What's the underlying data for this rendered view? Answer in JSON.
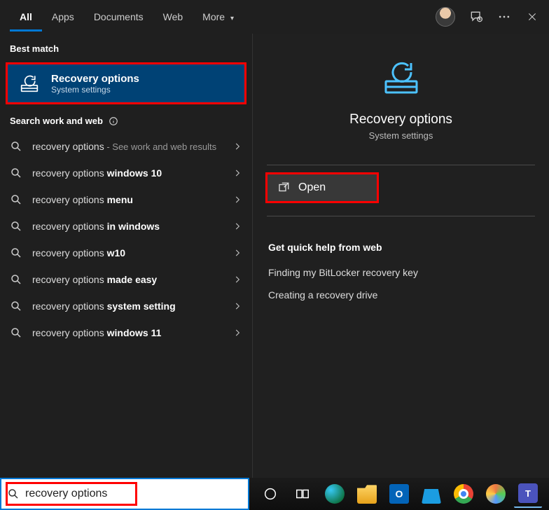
{
  "header": {
    "tabs": [
      "All",
      "Apps",
      "Documents",
      "Web",
      "More"
    ],
    "activeTab": 0
  },
  "leftPane": {
    "bestMatchLabel": "Best match",
    "bestMatch": {
      "title": "Recovery options",
      "subtitle": "System settings"
    },
    "searchWorkWebLabel": "Search work and web",
    "suggestions": [
      {
        "prefix": "recovery options",
        "bold": "",
        "sub": " - See work and web results"
      },
      {
        "prefix": "recovery options ",
        "bold": "windows 10",
        "sub": ""
      },
      {
        "prefix": "recovery options ",
        "bold": "menu",
        "sub": ""
      },
      {
        "prefix": "recovery options ",
        "bold": "in windows",
        "sub": ""
      },
      {
        "prefix": "recovery options ",
        "bold": "w10",
        "sub": ""
      },
      {
        "prefix": "recovery options ",
        "bold": "made easy",
        "sub": ""
      },
      {
        "prefix": "recovery options ",
        "bold": "system setting",
        "sub": ""
      },
      {
        "prefix": "recovery options ",
        "bold": "windows 11",
        "sub": ""
      }
    ]
  },
  "rightPane": {
    "title": "Recovery options",
    "subtitle": "System settings",
    "openLabel": "Open",
    "helpHeader": "Get quick help from web",
    "helpLinks": [
      "Finding my BitLocker recovery key",
      "Creating a recovery drive"
    ]
  },
  "taskbar": {
    "searchValue": "recovery options",
    "apps": [
      "cortana",
      "task-view",
      "edge",
      "file-explorer",
      "outlook",
      "store",
      "chrome",
      "paint",
      "teams"
    ]
  },
  "colors": {
    "accent": "#0078d4",
    "highlight": "#ff0000"
  }
}
